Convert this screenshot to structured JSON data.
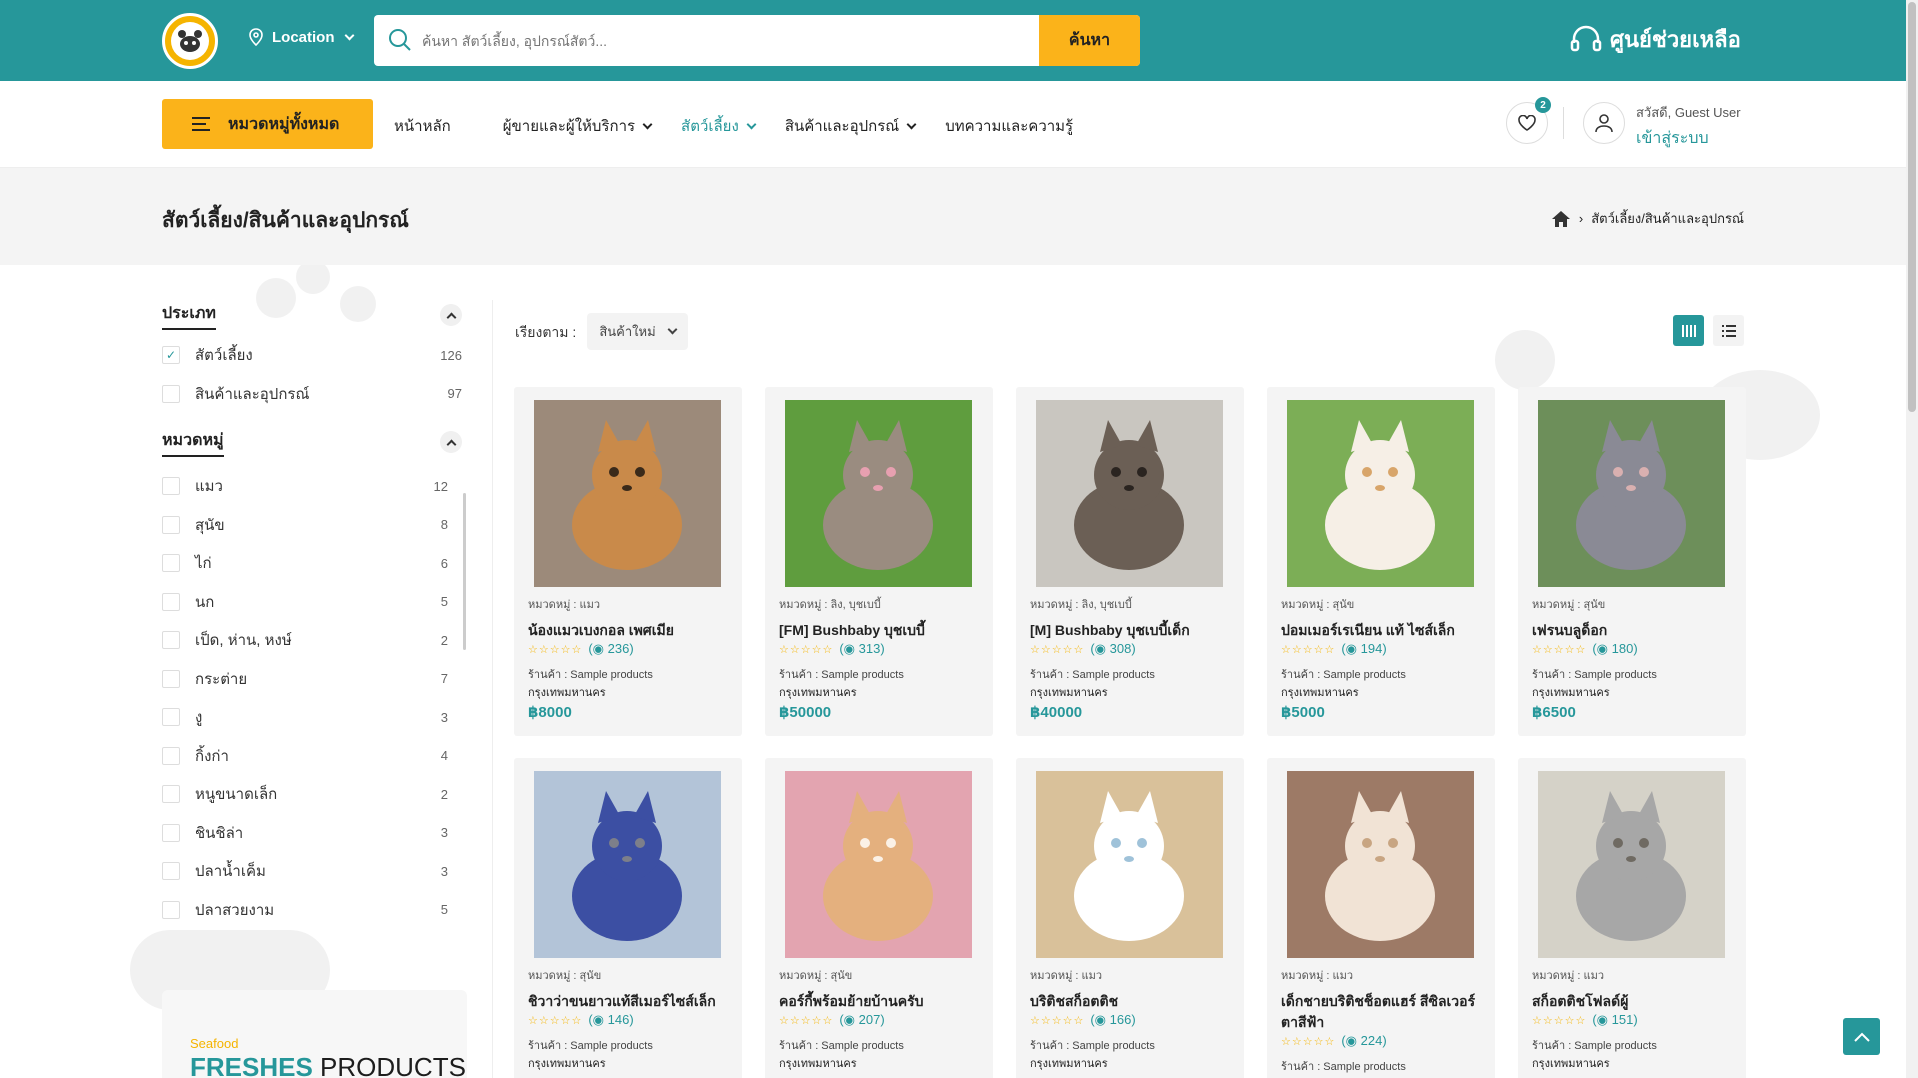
{
  "header": {
    "location_label": "Location",
    "search_placeholder": "ค้นหา สัตว์เลี้ยง, อุปกรณ์สัตว์...",
    "search_button": "ค้นหา",
    "help_center": "ศูนย์ช่วยเหลือ"
  },
  "nav": {
    "all_categories": "หมวดหมู่ทั้งหมด",
    "links": [
      "หน้าหลัก",
      "ผู้ขายและผู้ให้บริการ",
      "สัตว์เลี้ยง",
      "สินค้าและอุปกรณ์",
      "บทความและความรู้"
    ],
    "wishlist_count": "2",
    "greeting": "สวัสดี, Guest User",
    "login": "เข้าสู่ระบบ"
  },
  "page": {
    "title": "สัตว์เลี้ยง/สินค้าและอุปกรณ์",
    "breadcrumb_current": "สัตว์เลี้ยง/สินค้าและอุปกรณ์"
  },
  "filters": {
    "type_title": "ประเภท",
    "types": [
      {
        "label": "สัตว์เลี้ยง",
        "count": "126",
        "checked": true
      },
      {
        "label": "สินค้าและอุปกรณ์",
        "count": "97",
        "checked": false
      }
    ],
    "category_title": "หมวดหมู่",
    "categories": [
      {
        "label": "แมว",
        "count": "12"
      },
      {
        "label": "สุนัข",
        "count": "8"
      },
      {
        "label": "ไก่",
        "count": "6"
      },
      {
        "label": "นก",
        "count": "5"
      },
      {
        "label": "เป็ด, ห่าน, หงษ์",
        "count": "2"
      },
      {
        "label": "กระต่าย",
        "count": "7"
      },
      {
        "label": "งู",
        "count": "3"
      },
      {
        "label": "กิ้งก่า",
        "count": "4"
      },
      {
        "label": "หนูขนาดเล็ก",
        "count": "2"
      },
      {
        "label": "ชินชิล่า",
        "count": "3"
      },
      {
        "label": "ปลาน้ำเค็ม",
        "count": "3"
      },
      {
        "label": "ปลาสวยงาม",
        "count": "5"
      }
    ]
  },
  "promo": {
    "small": "Seafood",
    "big_bold": "FRESHES",
    "big_rest": " PRODUCTS"
  },
  "sort": {
    "label": "เรียงตาม :",
    "selected": "สินค้าใหม่"
  },
  "products": [
    {
      "category": "หมวดหมู่ : แมว",
      "name": "น้องแมวเบงกอล เพศเมีย",
      "views": "236",
      "shop": "ร้านค้า : Sample products",
      "city": "กรุงเทพมหานคร",
      "price": "฿8000",
      "art": "cat-bengal"
    },
    {
      "category": "หมวดหมู่ : ลิง, บุชเบบี้",
      "name": "[FM] Bushbaby บุชเบบี้",
      "views": "313",
      "shop": "ร้านค้า : Sample products",
      "city": "กรุงเทพมหานคร",
      "price": "฿50000",
      "art": "bushbaby"
    },
    {
      "category": "หมวดหมู่ : ลิง, บุชเบบี้",
      "name": "[M] Bushbaby บุชเบบี้เด็ก",
      "views": "308",
      "shop": "ร้านค้า : Sample products",
      "city": "กรุงเทพมหานคร",
      "price": "฿40000",
      "art": "bushbaby2"
    },
    {
      "category": "หมวดหมู่ : สุนัข",
      "name": "ปอมเมอร์เรเนียน แท้ ไซส์เล็ก",
      "views": "194",
      "shop": "ร้านค้า : Sample products",
      "city": "กรุงเทพมหานคร",
      "price": "฿5000",
      "art": "pomeranian"
    },
    {
      "category": "หมวดหมู่ : สุนัข",
      "name": "เฟรนบลูด็อก",
      "views": "180",
      "shop": "ร้านค้า : Sample products",
      "city": "กรุงเทพมหานคร",
      "price": "฿6500",
      "art": "frenchie"
    },
    {
      "category": "หมวดหมู่ : สุนัข",
      "name": "ชิวาว่าขนยาวแท้สีเมอร์ไซส์เล็ก",
      "views": "146",
      "shop": "ร้านค้า : Sample products",
      "city": "กรุงเทพมหานคร",
      "price": "",
      "art": "chihuahua"
    },
    {
      "category": "หมวดหมู่ : สุนัข",
      "name": "คอร์กี้พร้อมย้ายบ้านครับ",
      "views": "207",
      "shop": "ร้านค้า : Sample products",
      "city": "กรุงเทพมหานคร",
      "price": "",
      "art": "corgi"
    },
    {
      "category": "หมวดหมู่ : แมว",
      "name": "บริติชสก็อตติช",
      "views": "166",
      "shop": "ร้านค้า : Sample products",
      "city": "กรุงเทพมหานคร",
      "price": "",
      "art": "white-cat"
    },
    {
      "category": "หมวดหมู่ : แมว",
      "name": "เด็กชายบริติชช็อตแฮร์ สีซิลเวอร์ตาสีฟ้า",
      "views": "224",
      "shop": "ร้านค้า : Sample products",
      "city": "",
      "price": "",
      "art": "british"
    },
    {
      "category": "หมวดหมู่ : แมว",
      "name": "สก็อตติชโฟลด์ผู้",
      "views": "151",
      "shop": "ร้านค้า : Sample products",
      "city": "กรุงเทพมหานคร",
      "price": "",
      "art": "scottish"
    }
  ],
  "colors": {
    "primary": "#26979a",
    "accent": "#fbb31a"
  }
}
